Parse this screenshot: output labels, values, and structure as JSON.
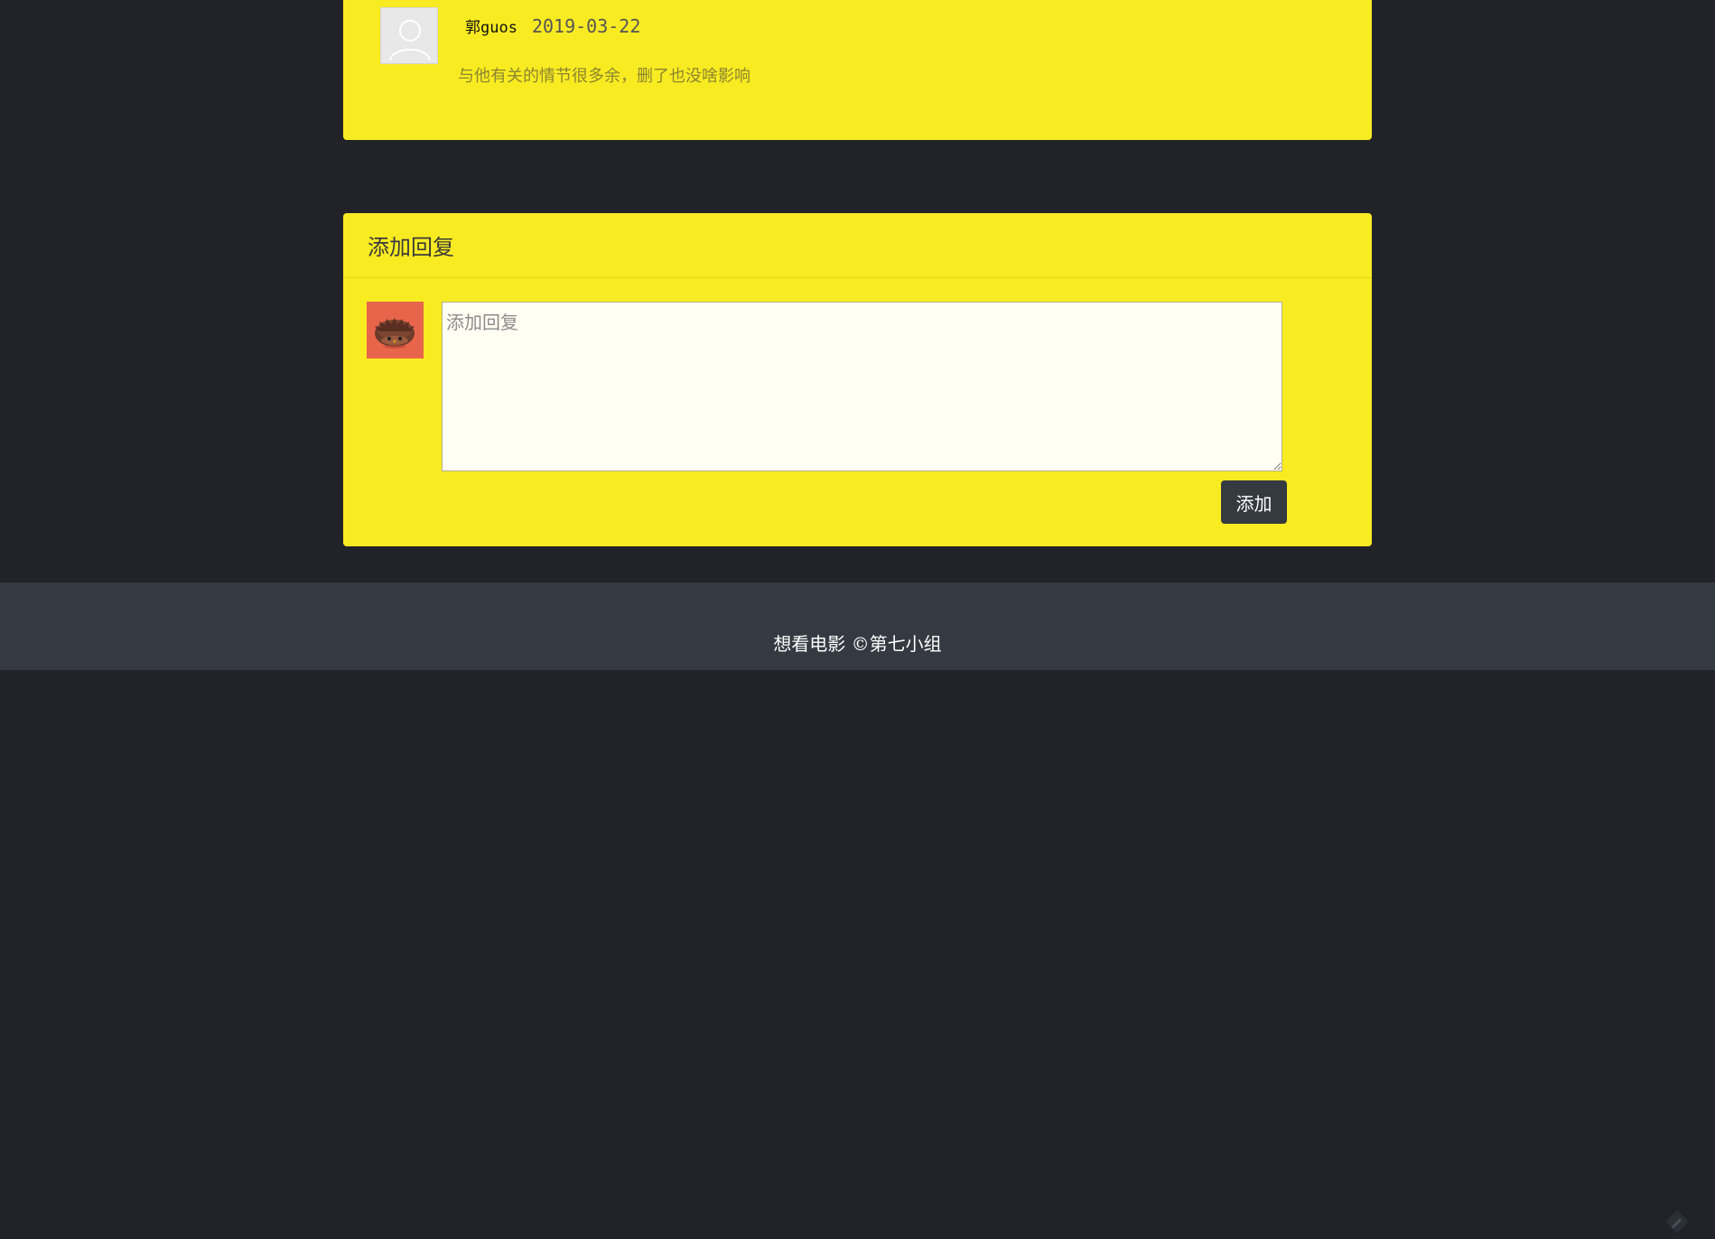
{
  "comment": {
    "author": "郭guos",
    "date": "2019-03-22",
    "text": "与他有关的情节很多余，删了也没啥影响"
  },
  "reply": {
    "title": "添加回复",
    "placeholder": "添加回复",
    "submit_label": "添加"
  },
  "footer": {
    "text": "想看电影 ©第七小组"
  },
  "icons": {
    "comment_avatar": "default-user-silhouette-icon",
    "user_avatar": "hedgehog-avatar-icon",
    "float_widget": "pencil-feedback-icon"
  },
  "colors": {
    "page_background": "#212328",
    "card_background": "#f9eb21",
    "textarea_background": "#fffff3",
    "button_background": "#343a40",
    "footer_background": "#353a42",
    "avatar_background": "#e8654b"
  }
}
